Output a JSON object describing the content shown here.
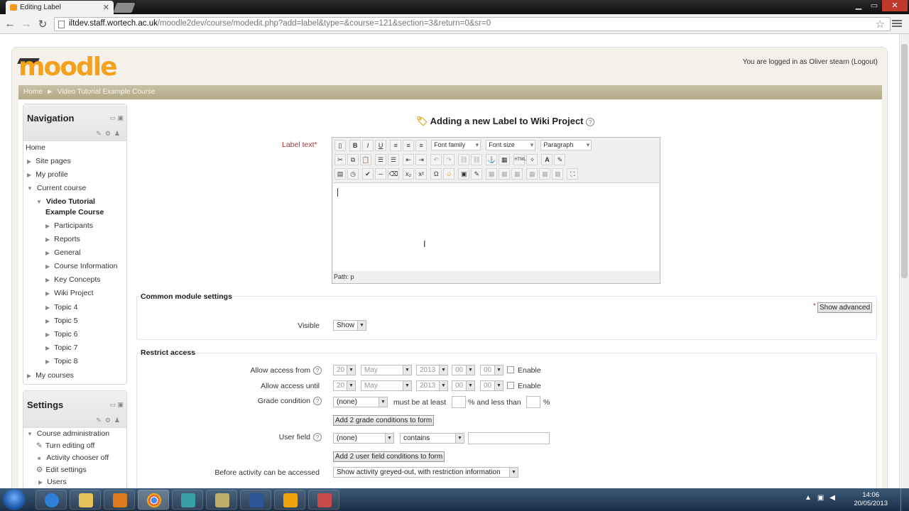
{
  "browser": {
    "tab_title": "Editing Label",
    "url_host": "iltdev.staff.wortech.ac.uk",
    "url_path": "/moodle2dev/course/modedit.php?add=label&type=&course=121&section=3&return=0&sr=0"
  },
  "site": {
    "logo_text": "moodle",
    "login_text": "You are logged in as Oliver stearn (Logout)",
    "breadcrumb": [
      "Home",
      "Video Tutorial Example Course"
    ]
  },
  "navigation": {
    "title": "Navigation",
    "home": "Home",
    "site_pages": "Site pages",
    "my_profile": "My profile",
    "current_course": "Current course",
    "course_name_line1": "Video Tutorial",
    "course_name_line2": "Example Course",
    "course_items": [
      "Participants",
      "Reports",
      "General",
      "Course Information",
      "Key Concepts",
      "Wiki Project",
      "Topic 4",
      "Topic 5",
      "Topic 6",
      "Topic 7",
      "Topic 8"
    ],
    "my_courses": "My courses"
  },
  "settings": {
    "title": "Settings",
    "course_admin": "Course administration",
    "items": [
      "Turn editing off",
      "Activity chooser off",
      "Edit settings",
      "Users"
    ]
  },
  "form": {
    "page_title": "Adding a new Label to Wiki Project",
    "label_text": "Label text",
    "required_mark": "*",
    "editor": {
      "font_family": "Font family",
      "font_size": "Font size",
      "paragraph": "Paragraph",
      "path": "Path: p"
    },
    "common_settings": {
      "legend": "Common module settings",
      "show_advanced": "Show advanced",
      "visible_label": "Visible",
      "visible_value": "Show"
    },
    "restrict": {
      "legend": "Restrict access",
      "from_label": "Allow access from",
      "until_label": "Allow access until",
      "day": "20",
      "month": "May",
      "year": "2013",
      "hour": "00",
      "minute": "00",
      "enable": "Enable",
      "grade_label": "Grade condition",
      "grade_value": "(none)",
      "must_be": "must be at least",
      "and_less": "% and less than",
      "percent": "%",
      "add_grade_btn": "Add 2 grade conditions to form",
      "user_field_label": "User field",
      "user_field_value": "(none)",
      "operator_value": "contains",
      "add_user_btn": "Add 2 user field conditions to form",
      "before_label": "Before activity can be accessed",
      "before_value": "Show activity greyed-out, with restriction information"
    }
  },
  "taskbar": {
    "time": "14:06",
    "date": "20/05/2013"
  }
}
